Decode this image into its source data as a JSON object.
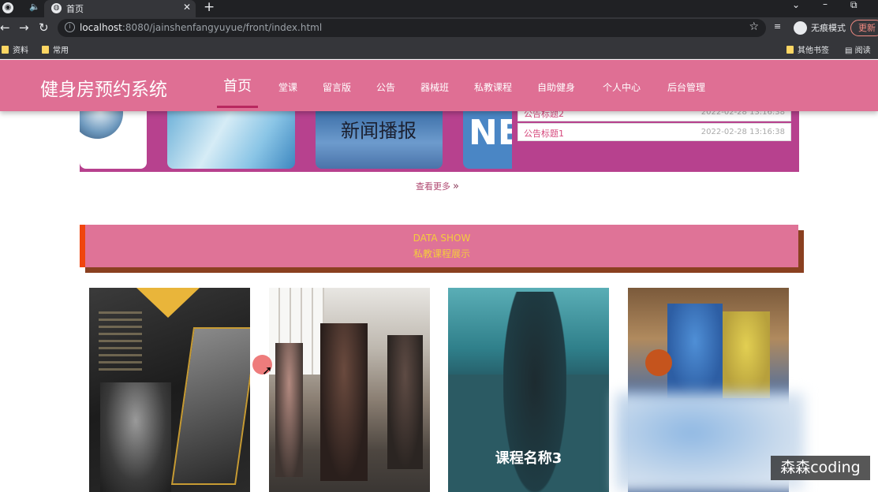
{
  "browser": {
    "tab_title": "首页",
    "new_tab": "+",
    "tab_close": "✕",
    "url_host": "localhost",
    "url_rest": ":8080/jainshenfangyuyue/front/index.html",
    "incognito_label": "无痕模式",
    "update_label": "更新",
    "bookmarks": {
      "b1": "资料",
      "b2": "常用",
      "b3": "其他书签",
      "b4": "阅读"
    }
  },
  "site": {
    "logo": "健身房预约系统",
    "nav": {
      "home": "首页",
      "lesson": "堂课",
      "message": "留言版",
      "notice": "公告",
      "equipment": "器械班",
      "private": "私教课程",
      "self": "自助健身",
      "personal": "个人中心",
      "admin": "后台管理"
    }
  },
  "carousel": {
    "slide3_text": "新闻播报",
    "slide4_text": "NE"
  },
  "notices": {
    "n2": {
      "title": "公告标题2",
      "date": "2022-02-28 13:16:38"
    },
    "n1": {
      "title": "公告标题1",
      "date": "2022-02-28 13:16:38"
    }
  },
  "more": {
    "label": "查看更多",
    "icon": "»"
  },
  "section": {
    "en": "DATA SHOW",
    "cn": "私教课程展示"
  },
  "cards": {
    "c3_title": "课程名称3"
  },
  "watermark": "森森coding",
  "colors": {
    "nav_pink": "#df6f94",
    "panel_magenta": "#b7418e",
    "banner_yellow": "#f4cd3c",
    "banner_orange": "#f0450e"
  }
}
